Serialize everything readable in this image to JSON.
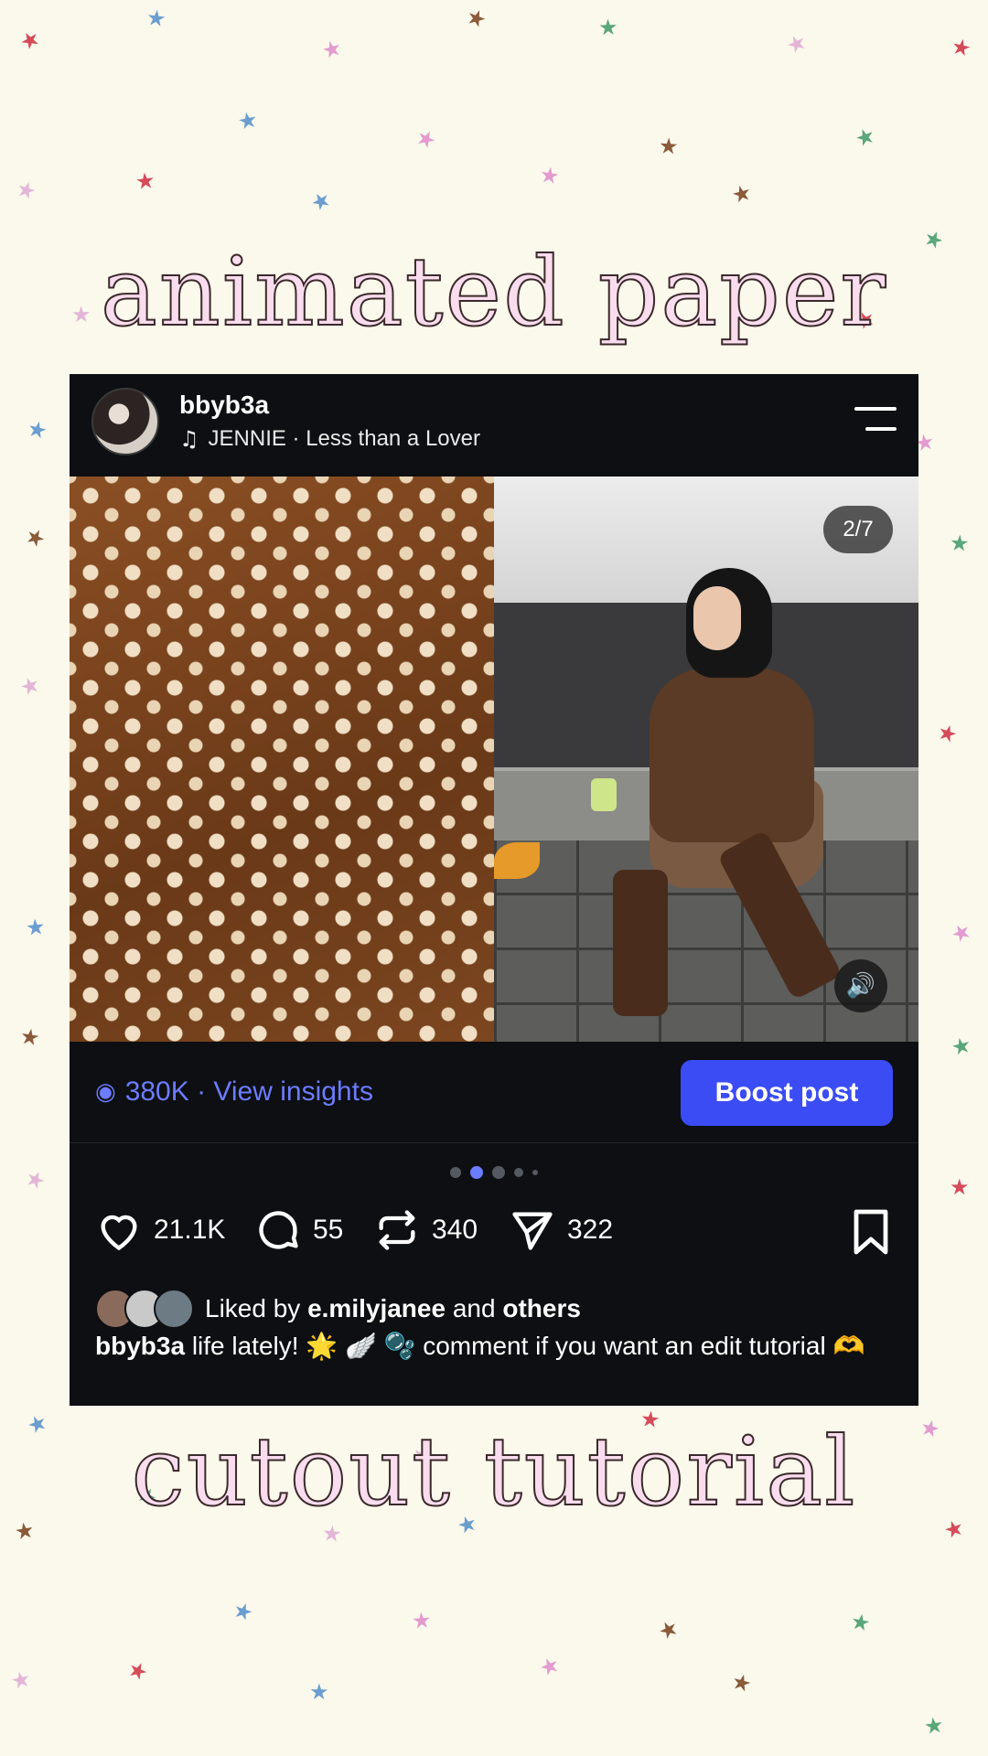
{
  "overlay": {
    "title_top": "animated paper",
    "title_bottom": "cutout tutorial",
    "star_colors": [
      "#d64b5a",
      "#6b9ecf",
      "#e39bd0",
      "#8a5a3a",
      "#5aa77a",
      "#e3b6d8"
    ]
  },
  "post": {
    "username": "bbyb3a",
    "music_icon": "music-note-icon",
    "music": "JENNIE · Less than a Lover",
    "menu_icon": "menu-icon",
    "media_counter": "2/7",
    "sound_icon": "speaker-icon",
    "insights": {
      "icon": "eye-icon",
      "text": "380K · View insights",
      "color": "#6b7cff"
    },
    "boost_button": "Boost post",
    "boost_color": "#3b4cf5",
    "carousel": {
      "total_dots": 5,
      "active_index": 1
    },
    "actions": {
      "likes": "21.1K",
      "comments": "55",
      "reposts": "340",
      "shares": "322"
    },
    "liked_by": {
      "prefix": "Liked by",
      "user": "e.milyjanee",
      "middle": "and",
      "others": "others"
    },
    "caption": {
      "username": "bbyb3a",
      "text": "life lately! 🌟 🪽 🫧 comment if you want an edit tutorial 🫶"
    }
  }
}
